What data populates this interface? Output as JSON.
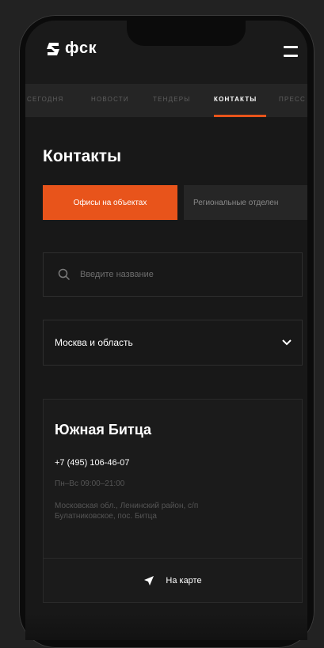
{
  "brand": {
    "name": "фск",
    "icon": "fsk-logo-mark"
  },
  "header": {
    "menu_icon": "hamburger-icon"
  },
  "nav": {
    "tabs": [
      {
        "label": "СЕГОДНЯ",
        "active": false
      },
      {
        "label": "НОВОСТИ",
        "active": false
      },
      {
        "label": "ТЕНДЕРЫ",
        "active": false
      },
      {
        "label": "КОНТАКТЫ",
        "active": true
      },
      {
        "label": "ПРЕСС",
        "active": false
      }
    ]
  },
  "page": {
    "title": "Контакты"
  },
  "filter_tabs": {
    "active_label": "Офисы на объектах",
    "inactive_label": "Региональные отделен"
  },
  "search": {
    "placeholder": "Введите название",
    "icon": "search-icon"
  },
  "region_select": {
    "value": "Москва и область",
    "icon": "chevron-down-icon"
  },
  "office_card": {
    "title": "Южная Битца",
    "phone": "+7 (495) 106-46-07",
    "hours": "Пн–Вс  09:00–21:00",
    "address": "Московская обл., Ленинский район, с/п Булатниковское, пос. Битца",
    "map_button": "На карте",
    "map_icon": "navigation-arrow-icon"
  },
  "colors": {
    "accent": "#e8541b",
    "background": "#181818",
    "frame": "#0b0b0b"
  }
}
